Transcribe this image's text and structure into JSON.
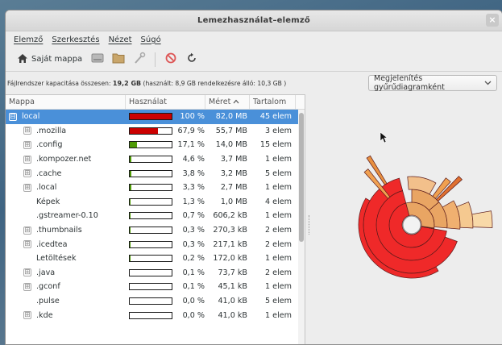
{
  "window": {
    "title": "Lemezhasználat–elemző",
    "close_label": "×"
  },
  "menu": {
    "items": [
      "Elemző",
      "Szerkesztés",
      "Nézet",
      "Súgó"
    ]
  },
  "toolbar": {
    "home_label": "Saját mappa"
  },
  "info": {
    "prefix": "Fájlrendszer kapacitása összesen: ",
    "total": "19,2 GB",
    "suffix": " (használt: 8,9 GB rendelkezésre álló: 10,3 GB )"
  },
  "view_select": {
    "value": "Megjelenítés gyűrűdiagramként"
  },
  "table": {
    "headers": {
      "name": "Mappa",
      "usage": "Használat",
      "size": "Méret",
      "count": "Tartalom"
    },
    "rows": [
      {
        "expander": "⊟",
        "name": "local",
        "pct": "100 %",
        "size": "82,0 MB",
        "count": "45 elem",
        "fill": 1.0,
        "color": "#cc0000",
        "selected": true
      },
      {
        "expander": "⊞",
        "name": ".mozilla",
        "pct": "67,9 %",
        "size": "55,7 MB",
        "count": "3 elem",
        "fill": 0.679,
        "color": "#cc0000"
      },
      {
        "expander": "⊞",
        "name": ".config",
        "pct": "17,1 %",
        "size": "14,0 MB",
        "count": "15 elem",
        "fill": 0.171,
        "color": "#4e9a06"
      },
      {
        "expander": "⊞",
        "name": ".kompozer.net",
        "pct": "4,6 %",
        "size": "3,7 MB",
        "count": "1 elem",
        "fill": 0.046,
        "color": "#4e9a06"
      },
      {
        "expander": "⊞",
        "name": ".cache",
        "pct": "3,8 %",
        "size": "3,2 MB",
        "count": "5 elem",
        "fill": 0.038,
        "color": "#4e9a06"
      },
      {
        "expander": "⊞",
        "name": ".local",
        "pct": "3,3 %",
        "size": "2,7 MB",
        "count": "1 elem",
        "fill": 0.033,
        "color": "#4e9a06"
      },
      {
        "expander": "",
        "name": "Képek",
        "pct": "1,3 %",
        "size": "1,0 MB",
        "count": "4 elem",
        "fill": 0.013,
        "color": "#4e9a06"
      },
      {
        "expander": "",
        "name": ".gstreamer-0.10",
        "pct": "0,7 %",
        "size": "606,2 kB",
        "count": "1 elem",
        "fill": 0.007,
        "color": "#4e9a06"
      },
      {
        "expander": "⊞",
        "name": ".thumbnails",
        "pct": "0,3 %",
        "size": "270,3 kB",
        "count": "2 elem",
        "fill": 0.003,
        "color": "#4e9a06"
      },
      {
        "expander": "⊞",
        "name": ".icedtea",
        "pct": "0,3 %",
        "size": "217,1 kB",
        "count": "2 elem",
        "fill": 0.003,
        "color": "#4e9a06"
      },
      {
        "expander": "",
        "name": "Letöltések",
        "pct": "0,2 %",
        "size": "172,0 kB",
        "count": "1 elem",
        "fill": 0.002,
        "color": "#4e9a06"
      },
      {
        "expander": "⊞",
        "name": ".java",
        "pct": "0,1 %",
        "size": "73,7 kB",
        "count": "2 elem",
        "fill": 0.001,
        "color": "#4e9a06"
      },
      {
        "expander": "⊞",
        "name": ".gconf",
        "pct": "0,1 %",
        "size": "45,1 kB",
        "count": "1 elem",
        "fill": 0.001,
        "color": "#4e9a06"
      },
      {
        "expander": "",
        "name": ".pulse",
        "pct": "0,0 %",
        "size": "41,0 kB",
        "count": "5 elem",
        "fill": 0.0,
        "color": "#4e9a06"
      },
      {
        "expander": "⊞",
        "name": ".kde",
        "pct": "0,0 %",
        "size": "41,0 kB",
        "count": "1 elem",
        "fill": 0.0,
        "color": "#4e9a06"
      }
    ]
  },
  "icons": {
    "home": "home-icon",
    "drive": "drive-icon",
    "folder": "folder-icon",
    "tools": "tools-icon",
    "stop": "stop-icon",
    "refresh": "refresh-icon",
    "sort": "sort-ascending-icon",
    "dropdown": "chevron-down-icon"
  },
  "colors": {
    "accent": "#4a90d9",
    "ring": "#ef2929"
  }
}
